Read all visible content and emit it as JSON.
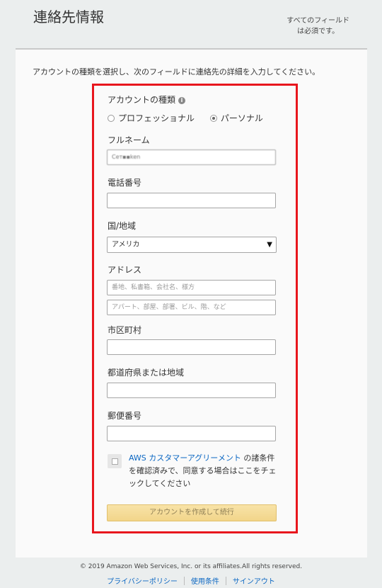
{
  "header": {
    "title": "連絡先情報",
    "required_line1": "すべてのフィールド",
    "required_line2": "は必須です。"
  },
  "intro": "アカウントの種類を選択し、次のフィールドに連絡先の詳細を入力してください。",
  "form": {
    "account_type_label": "アカウントの種類",
    "info_icon": "i",
    "account_type_options": [
      "プロフェッショナル",
      "パーソナル"
    ],
    "account_type_selected": "パーソナル",
    "fullname_label": "フルネーム",
    "fullname_value": "Ceт▪▪ken",
    "phone_label": "電話番号",
    "phone_value": "",
    "country_label": "国/地域",
    "country_value": "アメリカ",
    "address_label": "アドレス",
    "address1_placeholder": "番地、私書箱、会社名、様方",
    "address2_placeholder": "アパート、部屋、部署、ビル、階、など",
    "city_label": "市区町村",
    "state_label": "都道府県または地域",
    "postal_label": "郵便番号",
    "agreement_link": "AWS カスタマーアグリーメント",
    "agreement_text": " の諸条件を確認済みで、同意する場合はここをチェックしてください",
    "agreement_checked": false,
    "submit_label": "アカウントを作成して続行"
  },
  "footer": {
    "copyright": "© 2019 Amazon Web Services, Inc. or its affiliates.All rights reserved.",
    "links": [
      "プライバシーポリシー",
      "使用条件",
      "サインアウト"
    ]
  },
  "colors": {
    "highlight_border": "#e8161d",
    "link": "#0a66c2",
    "button": "#f2d58a"
  }
}
